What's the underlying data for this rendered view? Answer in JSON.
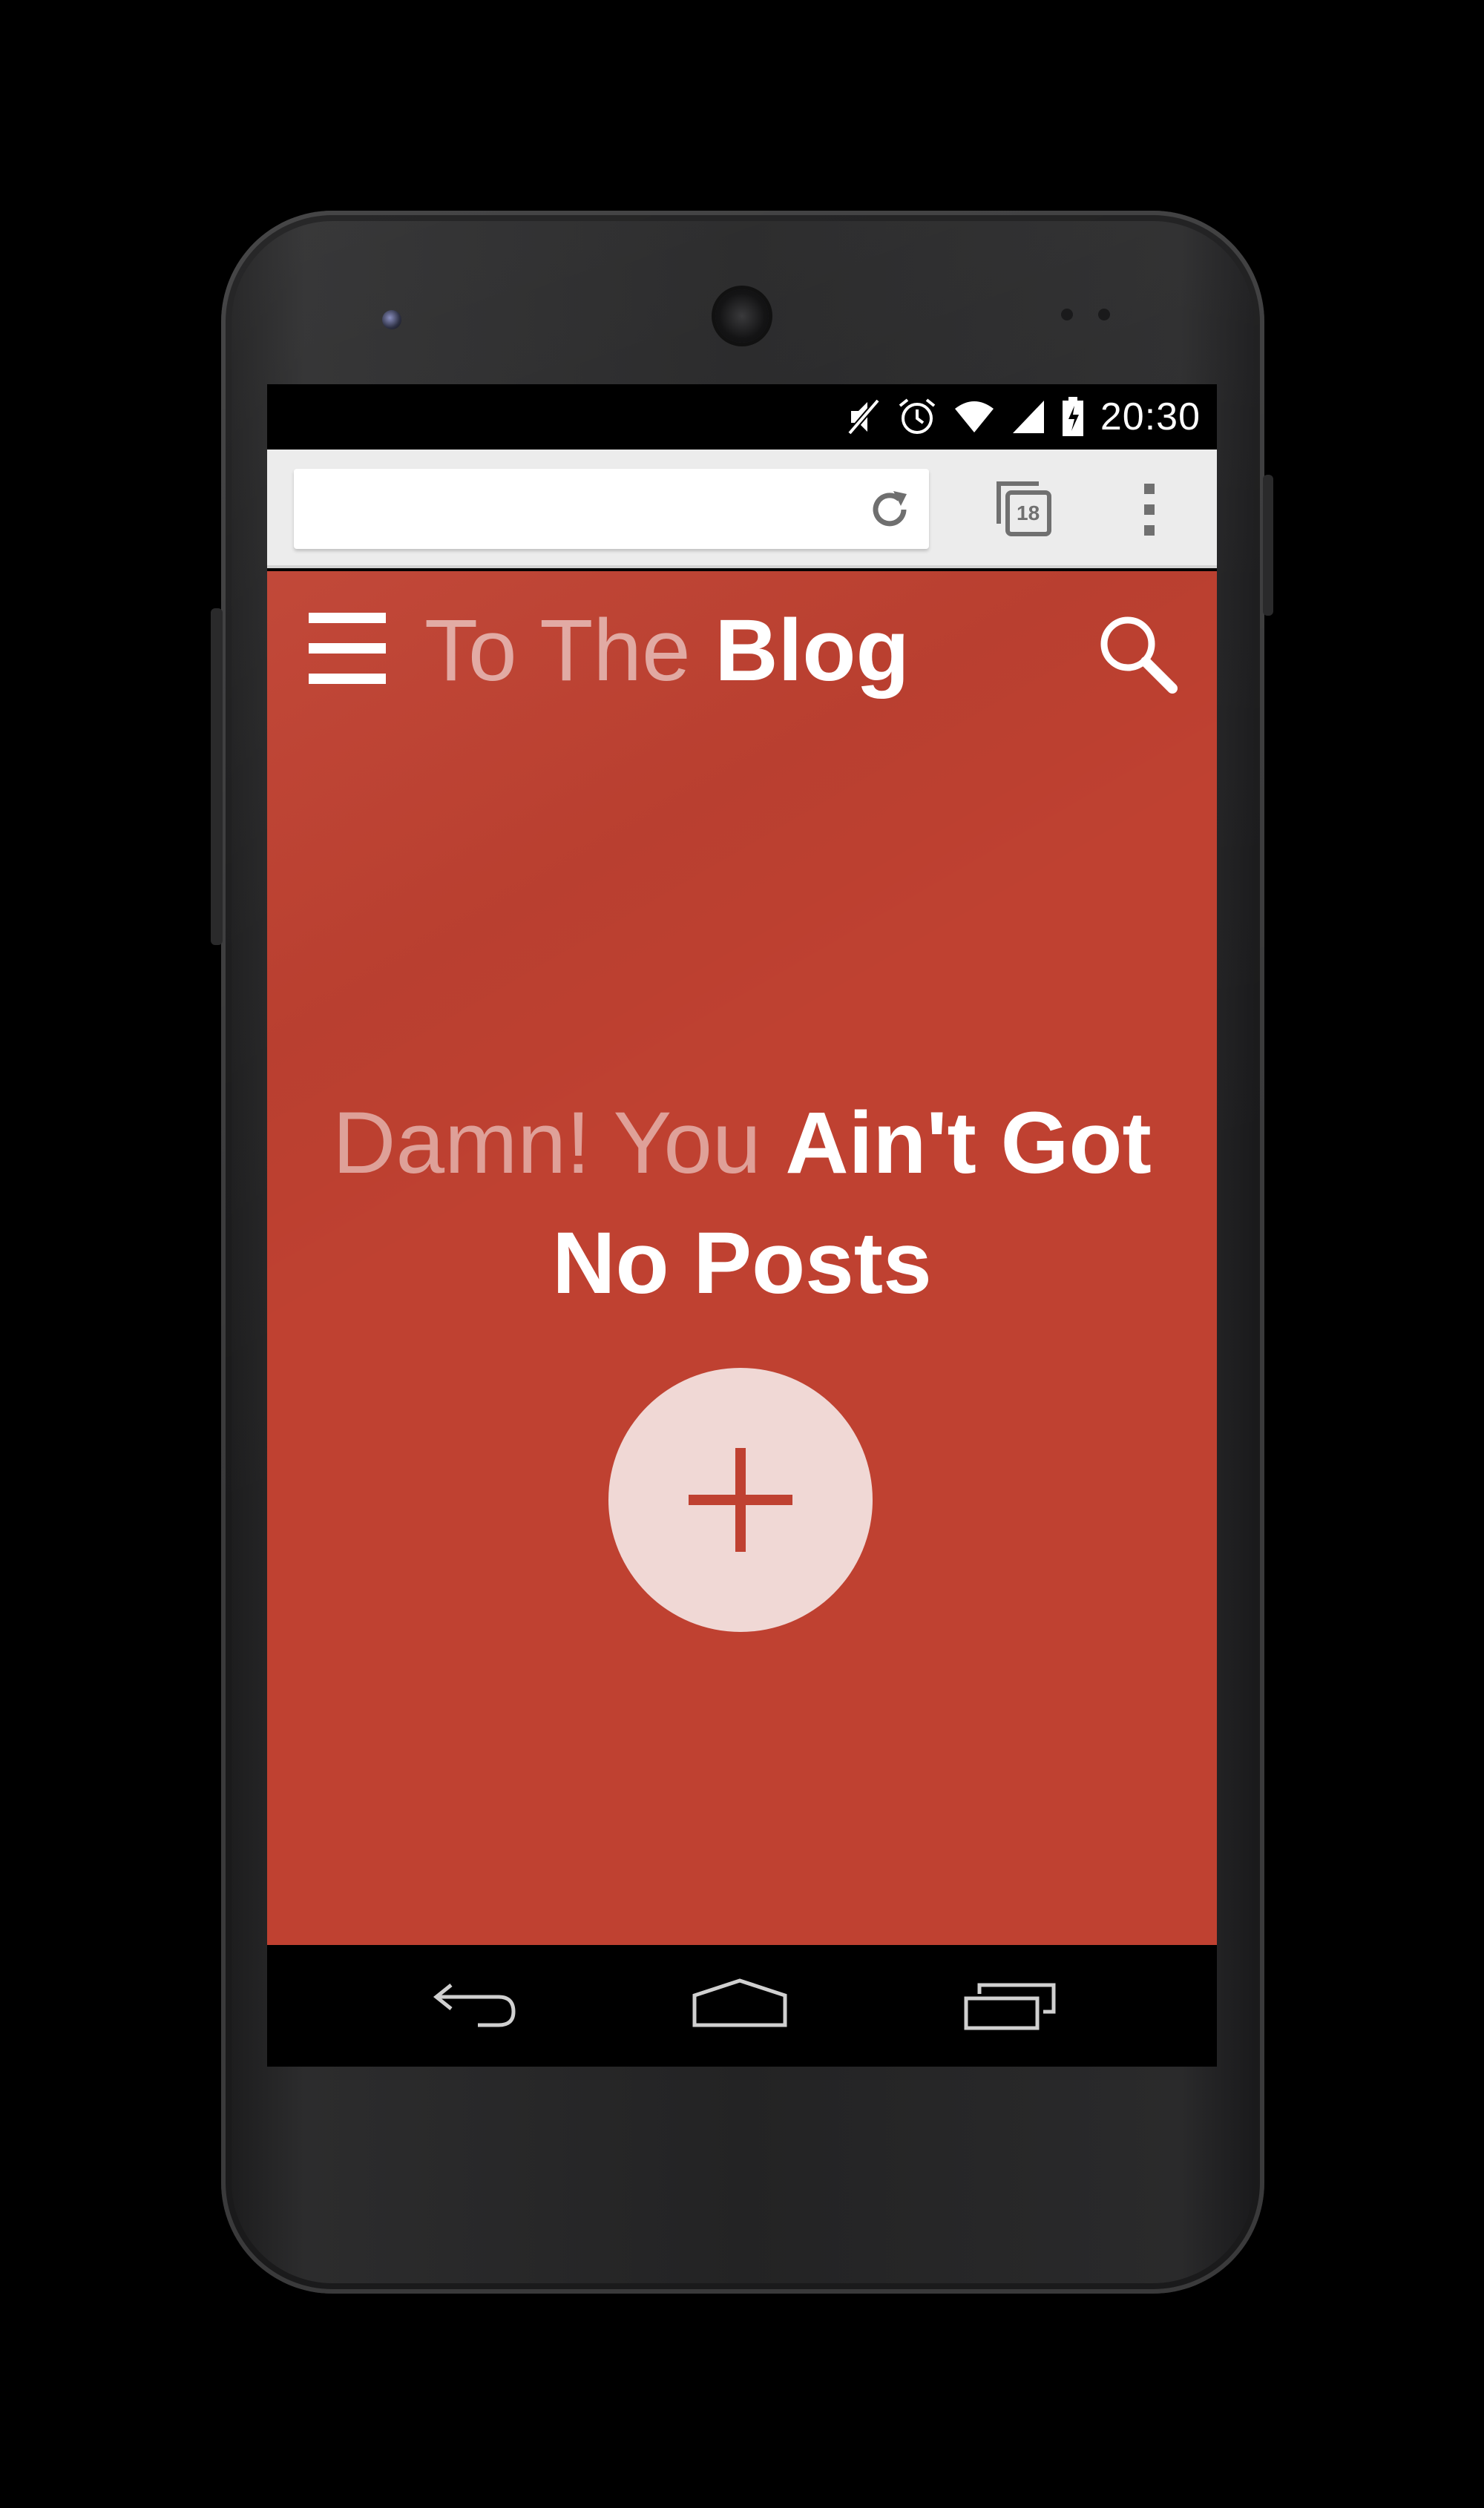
{
  "status_bar": {
    "time": "20:30",
    "icons": [
      "muted-icon",
      "alarm-icon",
      "wifi-icon",
      "signal-icon",
      "battery-icon"
    ]
  },
  "browser": {
    "url_value": "",
    "tabs_count": "18",
    "icons": [
      "reload-icon",
      "tabs-icon",
      "overflow-menu-icon"
    ]
  },
  "page": {
    "title_light": "To The ",
    "title_bold": "Blog",
    "empty_light": "Damn! You ",
    "empty_bold_1": "Ain't Got",
    "empty_bold_2": "No Posts",
    "accent_color": "#bf4131",
    "icons": [
      "hamburger-menu-icon",
      "search-icon",
      "add-icon"
    ]
  },
  "nav_bar": {
    "icons": [
      "back-icon",
      "home-icon",
      "recents-icon"
    ]
  }
}
